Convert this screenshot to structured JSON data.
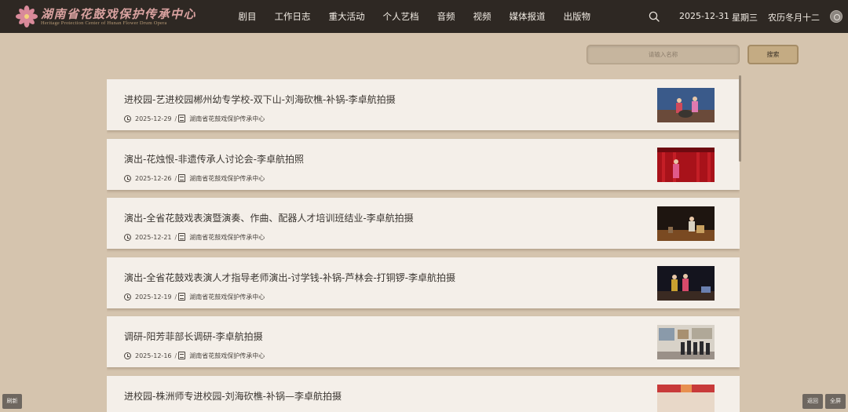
{
  "header": {
    "logo_title": "湖南省花鼓戏保护传承中心",
    "logo_subtitle": "Heritage Protection Center of Hunan Flower Drum Opera",
    "nav": [
      {
        "label": "剧目"
      },
      {
        "label": "工作日志"
      },
      {
        "label": "重大活动"
      },
      {
        "label": "个人艺档"
      },
      {
        "label": "音频"
      },
      {
        "label": "视频"
      },
      {
        "label": "媒体报道"
      },
      {
        "label": "出版物"
      }
    ],
    "date": "2025-12-31",
    "weekday": "星期三",
    "lunar": "农历冬月十二",
    "search_icon": "search-icon",
    "user_icon": "user-icon"
  },
  "search": {
    "placeholder": "请输入名称",
    "button": "搜索"
  },
  "list": {
    "items": [
      {
        "title": "进校园-艺进校园郴州幼专学校-双下山-刘海砍樵-补锅-李卓航拍摄",
        "date": "2025-12-29",
        "source": "湖南省花鼓戏保护传承中心",
        "thumb": "stage-performance"
      },
      {
        "title": "演出-花烛恨-非遗传承人讨论会-李卓航拍照",
        "date": "2025-12-26",
        "source": "湖南省花鼓戏保护传承中心",
        "thumb": "red-curtain-stage"
      },
      {
        "title": "演出-全省花鼓戏表演暨演奏、作曲、配器人才培训班结业-李卓航拍摄",
        "date": "2025-12-21",
        "source": "湖南省花鼓戏保护传承中心",
        "thumb": "dark-stage"
      },
      {
        "title": "演出-全省花鼓戏表演人才指导老师演出-讨学钱-补锅-芦林会-打铜锣-李卓航拍摄",
        "date": "2025-12-19",
        "source": "湖南省花鼓戏保护传承中心",
        "thumb": "night-stage"
      },
      {
        "title": "调研-阳芳菲部长调研-李卓航拍摄",
        "date": "2025-12-16",
        "source": "湖南省花鼓戏保护传承中心",
        "thumb": "exhibition-hall"
      },
      {
        "title": "进校园-株洲师专进校园-刘海砍樵-补锅—李卓航拍摄",
        "date": "",
        "source": "",
        "thumb": "school-event"
      }
    ]
  },
  "footer": {
    "refresh": "刷新",
    "back": "返回",
    "fullscreen": "全屏"
  },
  "colors": {
    "topbar": "#2e2823",
    "background": "#d5c4ae",
    "card": "#f4efe9",
    "accent": "#c4ab83"
  }
}
